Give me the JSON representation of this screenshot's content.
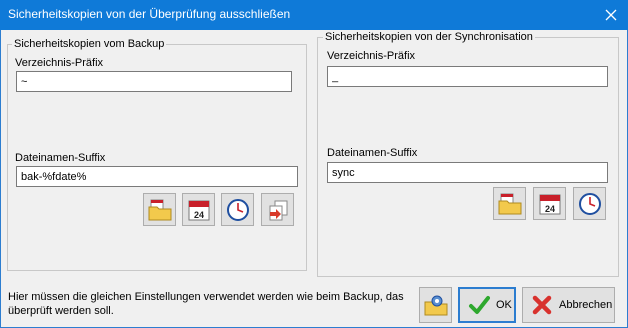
{
  "window": {
    "title": "Sicherheitskopien von der Überprüfung ausschließen"
  },
  "backup_group": {
    "legend": "Sicherheitskopien vom Backup",
    "prefix_label": "Verzeichnis-Präfix",
    "prefix_value": "~",
    "suffix_label": "Dateinamen-Suffix",
    "suffix_value": "bak-%fdate%",
    "buttons": [
      "folder-calendar-icon",
      "calendar-icon",
      "clock-icon",
      "copy-files-icon"
    ]
  },
  "sync_group": {
    "legend": "Sicherheitskopien von der Synchronisation",
    "prefix_label": "Verzeichnis-Präfix",
    "prefix_value": "_",
    "suffix_label": "Dateinamen-Suffix",
    "suffix_value": "sync",
    "buttons": [
      "folder-calendar-icon",
      "calendar-icon",
      "clock-icon"
    ]
  },
  "footer": {
    "status_text": "Hier müssen die gleichen Einstellungen verwendet werden wie beim Backup, das überprüft werden soll.",
    "ok_label": "OK",
    "cancel_label": "Abbrechen"
  },
  "colors": {
    "titlebar": "#0f7ad8",
    "ok_check": "#2ea82e",
    "cancel_x": "#d8322e"
  }
}
